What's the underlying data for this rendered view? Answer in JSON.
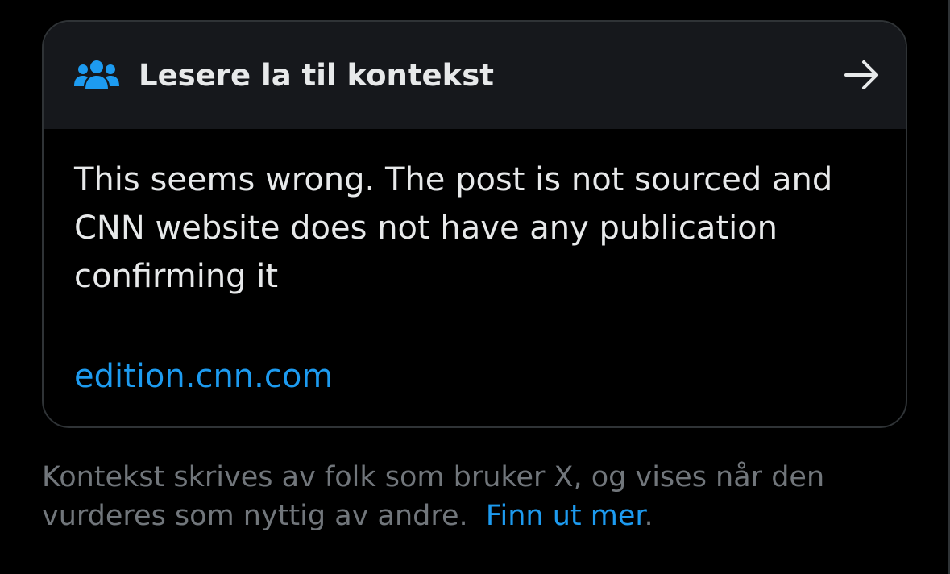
{
  "card": {
    "header": {
      "icon": "people-icon",
      "title": "Lesere la til kontekst",
      "action_icon": "arrow-right-icon"
    },
    "note_text": "This seems wrong. The post is not sourced and CNN website does not have any publication confirming it",
    "link_text": "edition.cnn.com"
  },
  "footer": {
    "text": "Kontekst skrives av folk som bruker X, og vises når den vurderes som nyttig av andre.",
    "link_text": "Finn ut mer",
    "link_suffix": "."
  },
  "colors": {
    "background": "#000000",
    "header_background": "#16181c",
    "border": "#2f3336",
    "primary_text": "#e7e9ea",
    "secondary_text": "#71767b",
    "accent": "#1d9bf0"
  }
}
